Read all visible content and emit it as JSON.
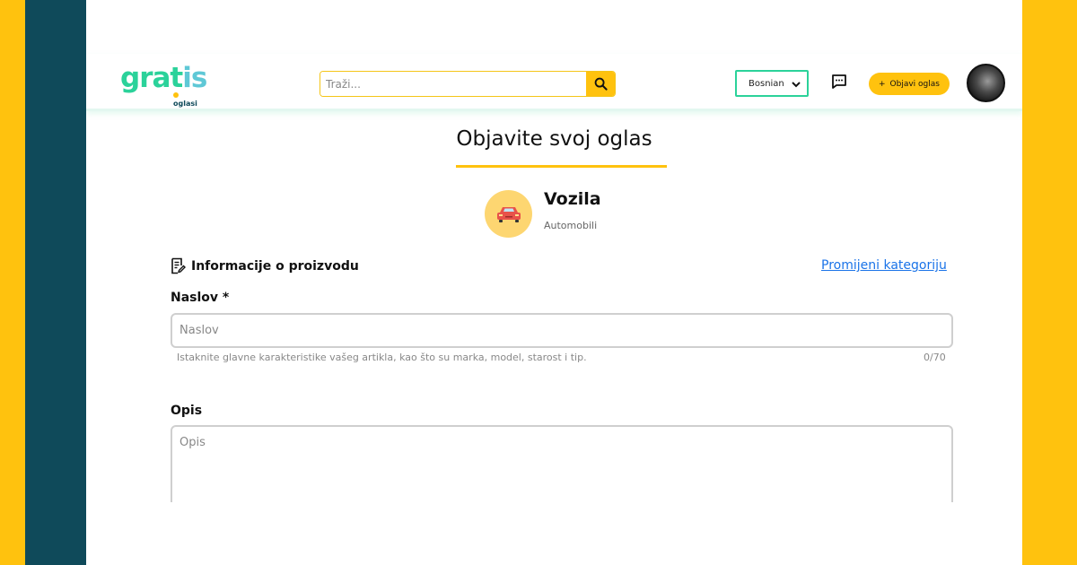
{
  "header": {
    "logo_text": "gratis",
    "logo_sub": "oglasi",
    "search_placeholder": "Traži...",
    "language": "Bosnian",
    "post_button_label": "Objavi oglas",
    "post_button_plus": "+"
  },
  "main": {
    "title": "Objavite svoj oglas",
    "category": {
      "name": "Vozila",
      "subcategory": "Automobili",
      "icon": "car-icon"
    },
    "section_title": "Informacije o proizvodu",
    "change_category_link": "Promijeni kategoriju",
    "fields": {
      "title_label": "Naslov *",
      "title_placeholder": "Naslov",
      "title_value": "",
      "title_helper": "Istaknite glavne karakteristike vašeg artikla, kao što su marka, model, starost i tip.",
      "title_counter": "0/70",
      "description_label": "Opis",
      "description_placeholder": "Opis",
      "description_value": ""
    }
  },
  "colors": {
    "accent_yellow": "#ffc20e",
    "brand_green": "#2bd29a",
    "side_teal": "#0f4a5a",
    "link_blue": "#1a73e8"
  }
}
